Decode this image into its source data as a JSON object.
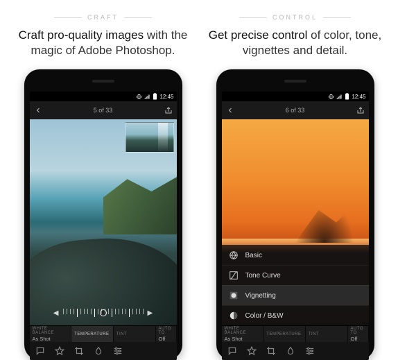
{
  "left": {
    "eyebrow": "CRAFT",
    "headline_em": "Craft pro-quality images",
    "headline_rest": " with the magic of Adobe Photoshop.",
    "status": {
      "time": "12:45"
    },
    "appbar": {
      "counter": "5 of 33"
    },
    "params": {
      "wb_label": "WHITE BALANCE",
      "wb_value": "As Shot",
      "temp_label": "TEMPERATURE",
      "tint_label": "TINT",
      "auto_label": "AUTO TO",
      "auto_value": "Off"
    }
  },
  "right": {
    "eyebrow": "CONTROL",
    "headline_em": "Get precise control",
    "headline_rest": " of color, tone, vignettes and detail.",
    "status": {
      "time": "12:45"
    },
    "appbar": {
      "counter": "6 of 33"
    },
    "tools": {
      "basic": "Basic",
      "tonecurve": "Tone Curve",
      "vignetting": "Vignetting",
      "colorbw": "Color / B&W"
    },
    "params": {
      "wb_label": "WHITE BALANCE",
      "wb_value": "As Shot",
      "temp_label": "TEMPERATURE",
      "tint_label": "TINT",
      "auto_label": "AUTO TO",
      "auto_value": "Off"
    }
  }
}
